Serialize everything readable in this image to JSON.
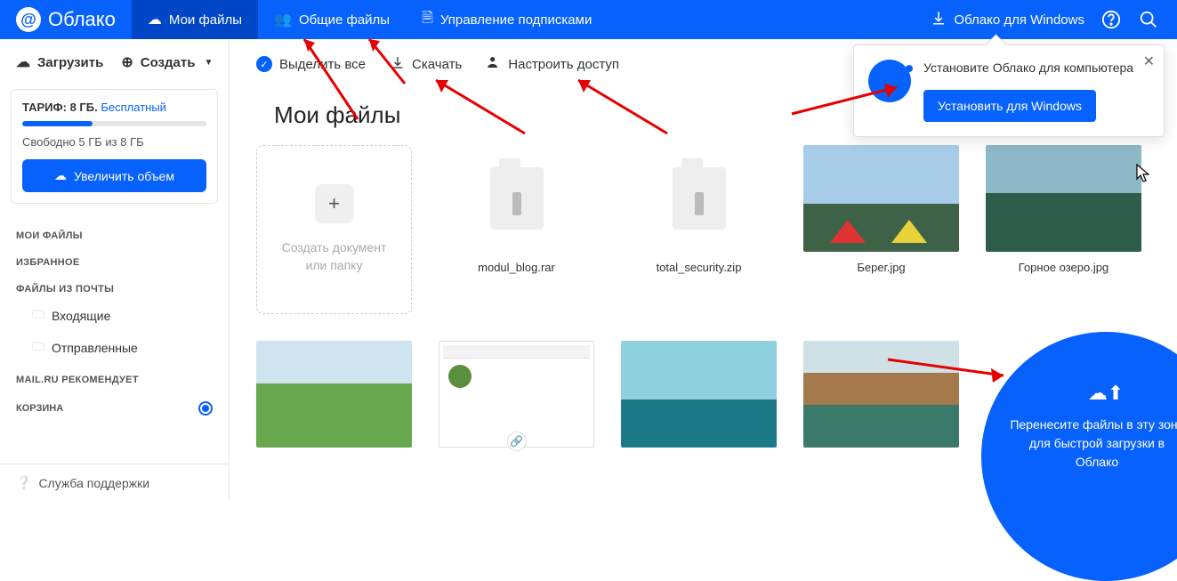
{
  "brand": {
    "name": "Облако",
    "at": "@"
  },
  "nav": {
    "my_files": "Мои файлы",
    "shared": "Общие файлы",
    "subscriptions": "Управление подписками"
  },
  "header_right": {
    "windows": "Облако для Windows"
  },
  "sidebar": {
    "upload": "Загрузить",
    "create": "Создать",
    "tariff_label": "ТАРИФ:",
    "tariff_size": "8 ГБ.",
    "tariff_plan": "Бесплатный",
    "storage_free": "Свободно 5 ГБ из 8 ГБ",
    "increase": "Увеличить объем",
    "sections": {
      "my_files": "МОИ ФАЙЛЫ",
      "favorites": "ИЗБРАННОЕ",
      "mail_files": "ФАЙЛЫ ИЗ ПОЧТЫ",
      "inbox": "Входящие",
      "sent": "Отправленные",
      "recommend": "MAIL.RU РЕКОМЕНДУЕТ",
      "trash": "КОРЗИНА",
      "support": "Служба поддержки"
    }
  },
  "toolbar": {
    "select_all": "Выделить все",
    "download": "Скачать",
    "share": "Настроить доступ"
  },
  "page_title": "Мои файлы",
  "create_tile": {
    "line1": "Создать документ",
    "line2": "или папку"
  },
  "files": [
    {
      "name": "modul_blog.rar",
      "type": "archive"
    },
    {
      "name": "total_security.zip",
      "type": "archive"
    },
    {
      "name": "Берег.jpg",
      "type": "image"
    },
    {
      "name": "Горное озеро.jpg",
      "type": "image"
    }
  ],
  "popup": {
    "text": "Установите Облако для компьютера",
    "button": "Установить для Windows"
  },
  "dropzone": {
    "text": "Перенесите файлы в эту зону для быстрой загрузки в Облако"
  }
}
